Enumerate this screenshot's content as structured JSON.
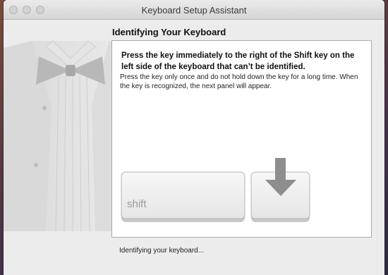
{
  "window": {
    "title": "Keyboard Setup Assistant"
  },
  "main": {
    "heading": "Identifying Your Keyboard",
    "instruction_bold": "Press the key immediately to the right of the Shift key on the left side of the keyboard that can’t be identified.",
    "instruction": "Press the key only once and do not hold down the key for a long time. When the key is recognized, the next panel will appear.",
    "keys": {
      "shift_label": "shift"
    }
  },
  "status": {
    "text": "Identifying your keyboard..."
  },
  "icons": {
    "illustration": "tuxedo-illustration-icon",
    "arrow": "down-arrow-icon"
  },
  "colors": {
    "window_bg": "#ececec",
    "panel_bg": "#ffffff",
    "key_fill": "#efefef",
    "arrow": "#8e8e8e"
  }
}
